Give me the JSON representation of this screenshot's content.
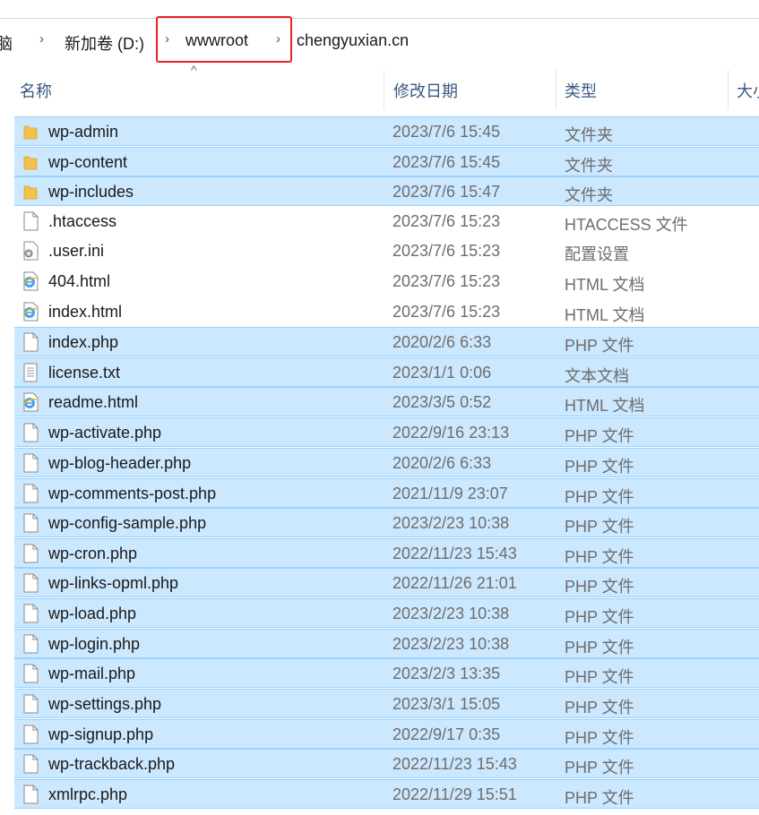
{
  "address": {
    "crumbs": [
      "此电脑",
      "新加卷 (D:)",
      "wwwroot",
      "chengyuxian.cn"
    ],
    "visible_first": "脑",
    "visible_first_prefix": "电"
  },
  "columns": {
    "name": "名称",
    "date": "修改日期",
    "type": "类型",
    "size": "大小"
  },
  "files": [
    {
      "name": "wp-admin",
      "date": "2023/7/6 15:45",
      "type": "文件夹",
      "icon": "folder-icon",
      "selected": true
    },
    {
      "name": "wp-content",
      "date": "2023/7/6 15:45",
      "type": "文件夹",
      "icon": "folder-icon",
      "selected": true
    },
    {
      "name": "wp-includes",
      "date": "2023/7/6 15:47",
      "type": "文件夹",
      "icon": "folder-icon",
      "selected": true
    },
    {
      "name": ".htaccess",
      "date": "2023/7/6 15:23",
      "type": "HTACCESS 文件",
      "icon": "file-icon",
      "selected": false
    },
    {
      "name": ".user.ini",
      "date": "2023/7/6 15:23",
      "type": "配置设置",
      "icon": "settings-file-icon",
      "selected": false
    },
    {
      "name": "404.html",
      "date": "2023/7/6 15:23",
      "type": "HTML 文档",
      "icon": "ie-html-icon",
      "selected": false
    },
    {
      "name": "index.html",
      "date": "2023/7/6 15:23",
      "type": "HTML 文档",
      "icon": "ie-html-icon",
      "selected": false
    },
    {
      "name": "index.php",
      "date": "2020/2/6 6:33",
      "type": "PHP 文件",
      "icon": "file-icon",
      "selected": true
    },
    {
      "name": "license.txt",
      "date": "2023/1/1 0:06",
      "type": "文本文档",
      "icon": "text-file-icon",
      "selected": true
    },
    {
      "name": "readme.html",
      "date": "2023/3/5 0:52",
      "type": "HTML 文档",
      "icon": "ie-html-icon",
      "selected": true
    },
    {
      "name": "wp-activate.php",
      "date": "2022/9/16 23:13",
      "type": "PHP 文件",
      "icon": "file-icon",
      "selected": true
    },
    {
      "name": "wp-blog-header.php",
      "date": "2020/2/6 6:33",
      "type": "PHP 文件",
      "icon": "file-icon",
      "selected": true
    },
    {
      "name": "wp-comments-post.php",
      "date": "2021/11/9 23:07",
      "type": "PHP 文件",
      "icon": "file-icon",
      "selected": true
    },
    {
      "name": "wp-config-sample.php",
      "date": "2023/2/23 10:38",
      "type": "PHP 文件",
      "icon": "file-icon",
      "selected": true
    },
    {
      "name": "wp-cron.php",
      "date": "2022/11/23 15:43",
      "type": "PHP 文件",
      "icon": "file-icon",
      "selected": true
    },
    {
      "name": "wp-links-opml.php",
      "date": "2022/11/26 21:01",
      "type": "PHP 文件",
      "icon": "file-icon",
      "selected": true
    },
    {
      "name": "wp-load.php",
      "date": "2023/2/23 10:38",
      "type": "PHP 文件",
      "icon": "file-icon",
      "selected": true
    },
    {
      "name": "wp-login.php",
      "date": "2023/2/23 10:38",
      "type": "PHP 文件",
      "icon": "file-icon",
      "selected": true
    },
    {
      "name": "wp-mail.php",
      "date": "2023/2/3 13:35",
      "type": "PHP 文件",
      "icon": "file-icon",
      "selected": true
    },
    {
      "name": "wp-settings.php",
      "date": "2023/3/1 15:05",
      "type": "PHP 文件",
      "icon": "file-icon",
      "selected": true
    },
    {
      "name": "wp-signup.php",
      "date": "2022/9/17 0:35",
      "type": "PHP 文件",
      "icon": "file-icon",
      "selected": true
    },
    {
      "name": "wp-trackback.php",
      "date": "2022/11/23 15:43",
      "type": "PHP 文件",
      "icon": "file-icon",
      "selected": true
    },
    {
      "name": "xmlrpc.php",
      "date": "2022/11/29 15:51",
      "type": "PHP 文件",
      "icon": "file-icon",
      "selected": true
    }
  ],
  "colors": {
    "selection": "#cce8ff",
    "selection_border": "#99d1ff",
    "highlight": "#e8232a",
    "folder": "#f2c14e"
  }
}
